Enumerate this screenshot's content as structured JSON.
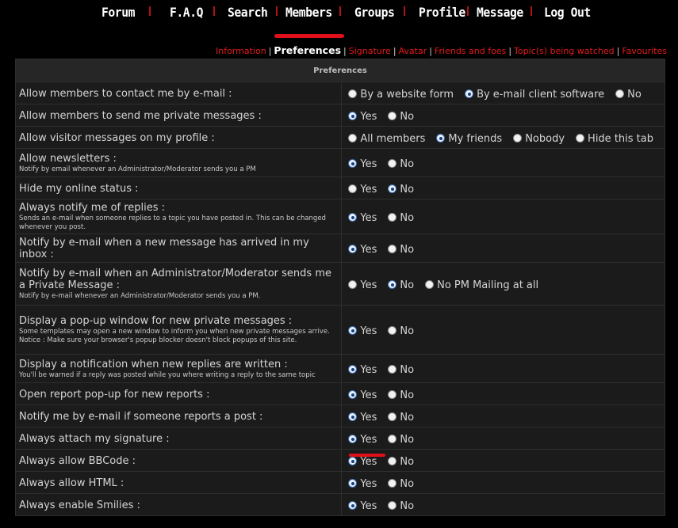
{
  "nav": {
    "items": [
      "Forum",
      "F.A.Q",
      "Search",
      "Members",
      "Groups",
      "Profile",
      "Message",
      "Log Out"
    ]
  },
  "subnav": {
    "items": [
      "Information",
      "Preferences",
      "Signature",
      "Avatar",
      "Friends and foes",
      "Topic(s) being watched",
      "Favourites"
    ],
    "active": "Preferences"
  },
  "table": {
    "header": "Preferences",
    "rows": [
      {
        "label": "Allow members to contact me by e-mail :",
        "desc": "",
        "options": [
          "By a website form",
          "By e-mail client software",
          "No"
        ],
        "selected": 1
      },
      {
        "label": "Allow members to send me private messages :",
        "desc": "",
        "options": [
          "Yes",
          "No"
        ],
        "selected": 0
      },
      {
        "label": "Allow visitor messages on my profile :",
        "desc": "",
        "options": [
          "All members",
          "My friends",
          "Nobody",
          "Hide this tab"
        ],
        "selected": 1
      },
      {
        "label": "Allow newsletters :",
        "desc": "Notify by email whenever an Administrator/Moderator sends you a PM",
        "options": [
          "Yes",
          "No"
        ],
        "selected": 0
      },
      {
        "label": "Hide my online status :",
        "desc": "",
        "options": [
          "Yes",
          "No"
        ],
        "selected": 1
      },
      {
        "label": "Always notify me of replies :",
        "desc": "Sends an e-mail when someone replies to a topic you have posted in. This can be changed whenever you post.",
        "options": [
          "Yes",
          "No"
        ],
        "selected": 0
      },
      {
        "label": "Notify by e-mail when a new message has arrived in my inbox :",
        "desc": "",
        "options": [
          "Yes",
          "No"
        ],
        "selected": 0
      },
      {
        "label": "Notify by e-mail when an Administrator/Moderator sends me a Private Message :",
        "desc": "Notify by e-mail whenever an Administrator/Moderator sends you a PM.",
        "options": [
          "Yes",
          "No",
          "No PM Mailing at all"
        ],
        "selected": 1
      },
      {
        "label": "Display a pop-up window for new private messages :",
        "desc": "Some templates may open a new window to inform you when new private messages arrive. Notice : Make sure your browser's popup blocker doesn't block popups of this site.",
        "options": [
          "Yes",
          "No"
        ],
        "selected": 0
      },
      {
        "label": "Display a notification when new replies are written :",
        "desc": "You'll be warned if a reply was posted while you where writing a reply to the same topic",
        "options": [
          "Yes",
          "No"
        ],
        "selected": 0
      },
      {
        "label": "Open report pop-up for new reports :",
        "desc": "",
        "options": [
          "Yes",
          "No"
        ],
        "selected": 0
      },
      {
        "label": "Notify me by e-mail if someone reports a post :",
        "desc": "",
        "options": [
          "Yes",
          "No"
        ],
        "selected": 0
      },
      {
        "label": "Always attach my signature :",
        "desc": "",
        "options": [
          "Yes",
          "No"
        ],
        "selected": 0
      },
      {
        "label": "Always allow BBCode :",
        "desc": "",
        "options": [
          "Yes",
          "No"
        ],
        "selected": 0
      },
      {
        "label": "Always allow HTML :",
        "desc": "",
        "options": [
          "Yes",
          "No"
        ],
        "selected": 0
      },
      {
        "label": "Always enable Smilies :",
        "desc": "",
        "options": [
          "Yes",
          "No"
        ],
        "selected": 0
      }
    ]
  },
  "colors": {
    "accent_red": "#e0101a",
    "link_red": "#e31b1b",
    "background": "#000000",
    "table_bg": "#1b1b1b"
  }
}
